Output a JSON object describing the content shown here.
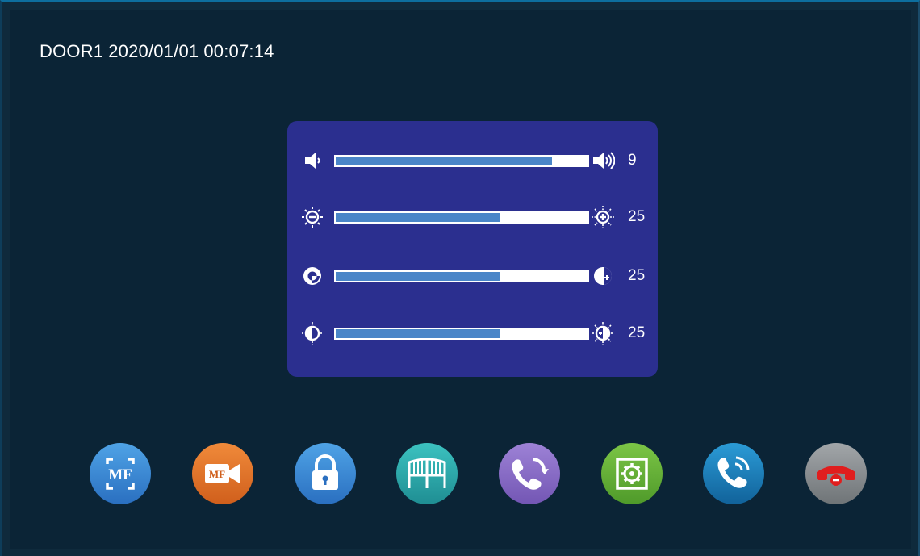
{
  "header": {
    "door": "DOOR1",
    "date": "2020/01/01",
    "time": "00:07:14"
  },
  "sliders": [
    {
      "name": "volume",
      "left_icon": "volume-low-icon",
      "right_icon": "volume-high-icon",
      "value": "9",
      "fill_fraction": 0.86
    },
    {
      "name": "brightness",
      "left_icon": "brightness-down-icon",
      "right_icon": "brightness-up-icon",
      "value": "25",
      "fill_fraction": 0.65
    },
    {
      "name": "contrast",
      "left_icon": "contrast-down-icon",
      "right_icon": "contrast-up-icon",
      "value": "25",
      "fill_fraction": 0.65
    },
    {
      "name": "color",
      "left_icon": "color-down-icon",
      "right_icon": "color-up-icon",
      "value": "25",
      "fill_fraction": 0.65
    }
  ],
  "dock": {
    "buttons": [
      {
        "name": "snapshot-button",
        "icon": "mf-capture-icon",
        "label": "MF",
        "color": "#3d8fd6"
      },
      {
        "name": "record-button",
        "icon": "mf-video-icon",
        "label": "MF",
        "color": "#e2732a"
      },
      {
        "name": "unlock-button",
        "icon": "lock-icon",
        "color": "#3d8fd6"
      },
      {
        "name": "gate-button",
        "icon": "gate-icon",
        "color": "#2aa9a5"
      },
      {
        "name": "transfer-call-button",
        "icon": "call-transfer-icon",
        "color": "#8a6cc4"
      },
      {
        "name": "settings-button",
        "icon": "settings-icon",
        "color": "#6bb23b"
      },
      {
        "name": "call-button",
        "icon": "phone-call-icon",
        "color": "#1f7fb8"
      },
      {
        "name": "hangup-button",
        "icon": "hangup-icon",
        "color": "#8f9497",
        "accent": "#e01e1e"
      }
    ]
  }
}
